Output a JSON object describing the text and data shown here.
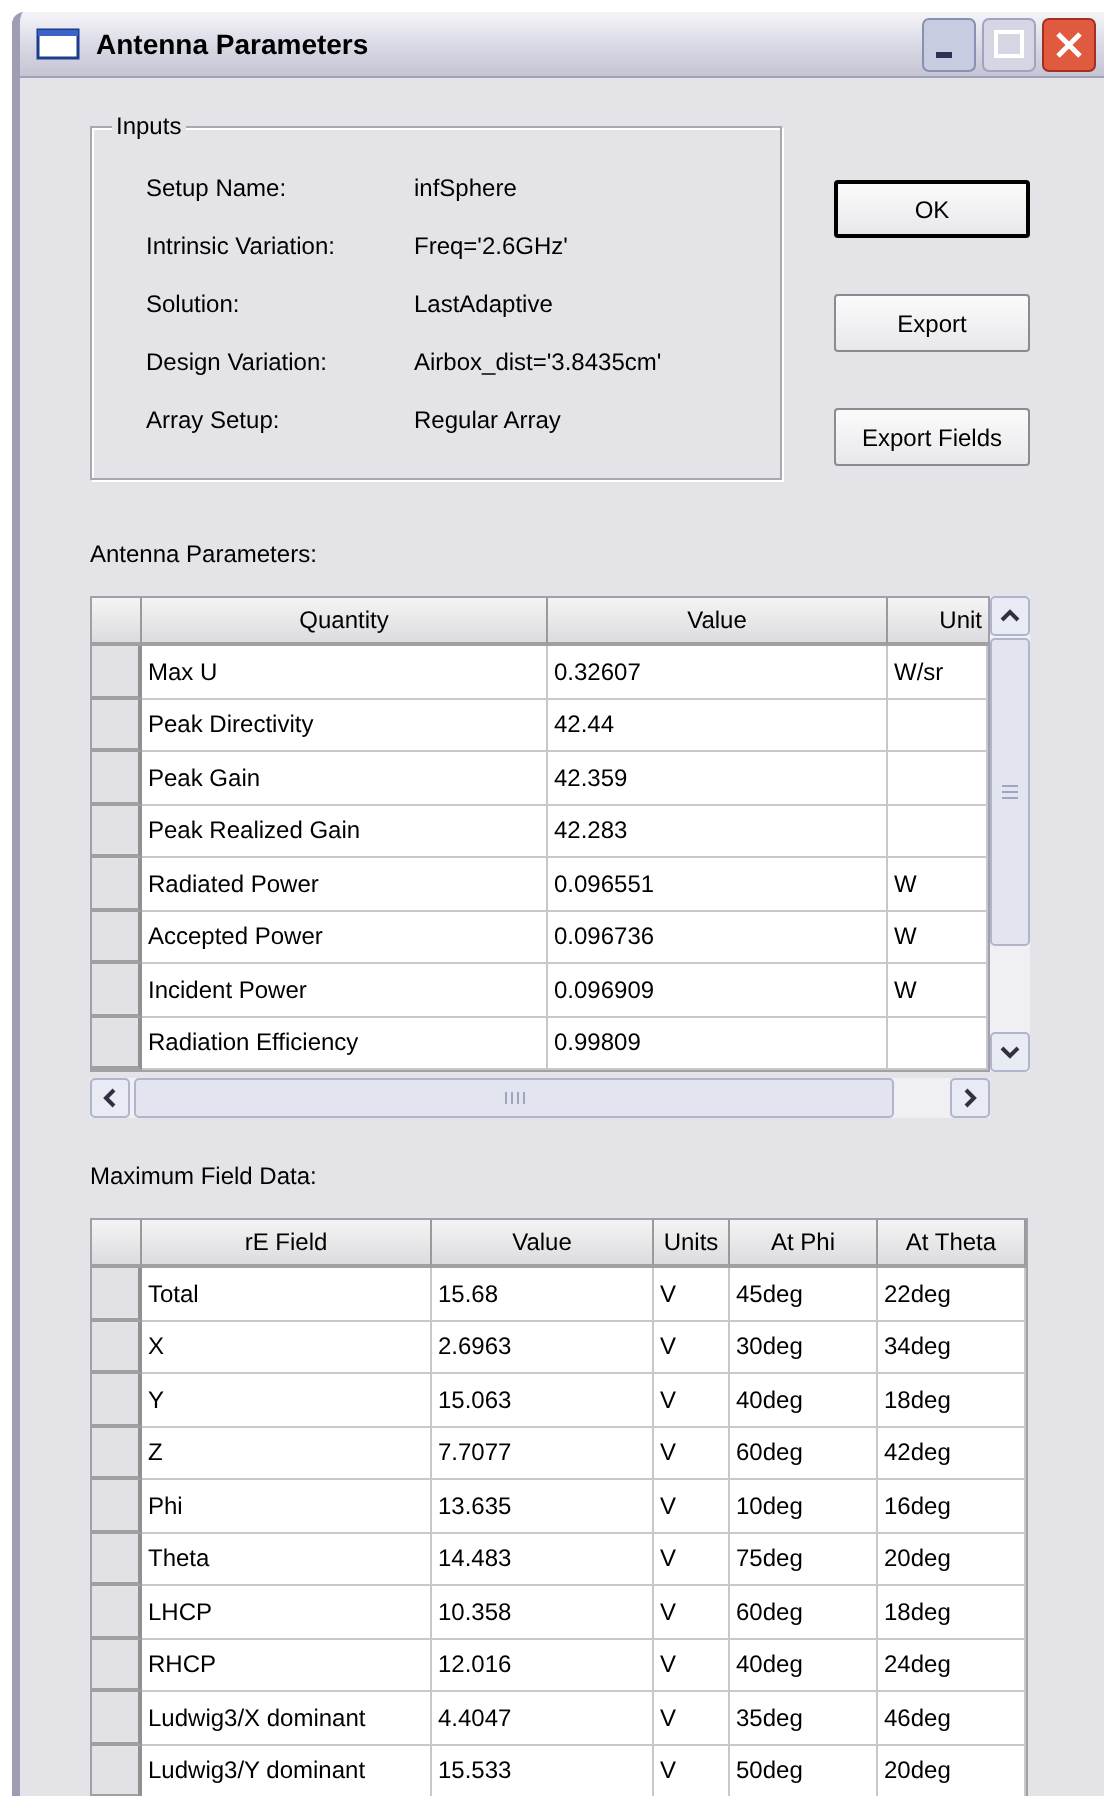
{
  "window": {
    "title": "Antenna Parameters"
  },
  "inputs": {
    "legend": "Inputs",
    "fields": [
      {
        "label": "Setup Name:",
        "value": "infSphere"
      },
      {
        "label": "Intrinsic Variation:",
        "value": "Freq='2.6GHz'"
      },
      {
        "label": "Solution:",
        "value": "LastAdaptive"
      },
      {
        "label": "Design Variation:",
        "value": "Airbox_dist='3.8435cm'"
      },
      {
        "label": "Array Setup:",
        "value": "Regular Array"
      }
    ]
  },
  "buttons": [
    {
      "label": "OK",
      "default": true
    },
    {
      "label": "Export",
      "default": false
    },
    {
      "label": "Export Fields",
      "default": false
    }
  ],
  "antenna_parameters": {
    "label": "Antenna Parameters:",
    "columns": [
      "Quantity",
      "Value",
      "Unit"
    ],
    "rows": [
      {
        "quantity": "Max U",
        "value": "0.32607",
        "units": "W/sr"
      },
      {
        "quantity": "Peak Directivity",
        "value": "42.44"
      },
      {
        "quantity": "Peak Gain",
        "value": "42.359"
      },
      {
        "quantity": "Peak Realized Gain",
        "value": "42.283"
      },
      {
        "quantity": "Radiated Power",
        "value": "0.096551",
        "units": "W"
      },
      {
        "quantity": "Accepted Power",
        "value": "0.096736",
        "units": "W"
      },
      {
        "quantity": "Incident Power",
        "value": "0.096909",
        "units": "W"
      },
      {
        "quantity": "Radiation Efficiency",
        "value": "0.99809"
      }
    ]
  },
  "maximum_field_data": {
    "label": "Maximum Field Data:",
    "columns": [
      "rE Field",
      "Value",
      "Units",
      "At Phi",
      "At Theta"
    ],
    "rows": [
      {
        "field": "Total",
        "value": "15.68",
        "units": "V",
        "at_phi": "45deg",
        "at_theta": "22deg"
      },
      {
        "field": "X",
        "value": "2.6963",
        "units": "V",
        "at_phi": "30deg",
        "at_theta": "34deg"
      },
      {
        "field": "Y",
        "value": "15.063",
        "units": "V",
        "at_phi": "40deg",
        "at_theta": "18deg"
      },
      {
        "field": "Z",
        "value": "7.7077",
        "units": "V",
        "at_phi": "60deg",
        "at_theta": "42deg"
      },
      {
        "field": "Phi",
        "value": "13.635",
        "units": "V",
        "at_phi": "10deg",
        "at_theta": "16deg"
      },
      {
        "field": "Theta",
        "value": "14.483",
        "units": "V",
        "at_phi": "75deg",
        "at_theta": "20deg"
      },
      {
        "field": "LHCP",
        "value": "10.358",
        "units": "V",
        "at_phi": "60deg",
        "at_theta": "18deg"
      },
      {
        "field": "RHCP",
        "value": "12.016",
        "units": "V",
        "at_phi": "40deg",
        "at_theta": "24deg"
      },
      {
        "field": "Ludwig3/X dominant",
        "value": "4.4047",
        "units": "V",
        "at_phi": "35deg",
        "at_theta": "46deg"
      },
      {
        "field": "Ludwig3/Y dominant",
        "value": "15.533",
        "units": "V",
        "at_phi": "50deg",
        "at_theta": "20deg"
      }
    ]
  }
}
